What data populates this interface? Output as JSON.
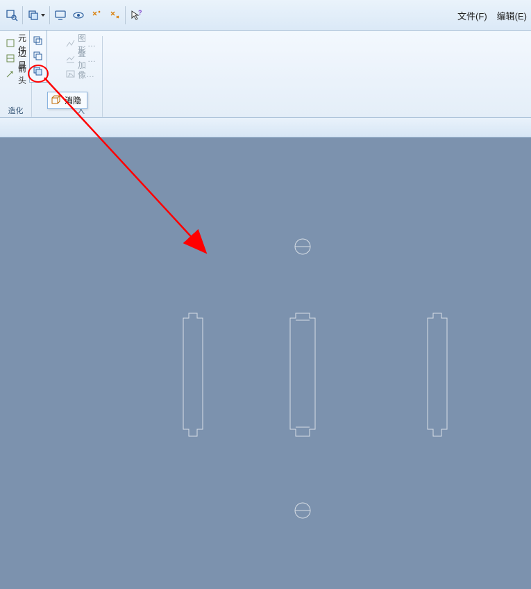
{
  "menus": {
    "file": "文件(F)",
    "edit": "编辑(E)"
  },
  "ribbon": {
    "group1": {
      "item1": "元件",
      "item2": "边显",
      "item3": "箭头",
      "label": "造化"
    },
    "group2": {
      "item1": "图形",
      "item2": "叠加",
      "item3": "像",
      "label": "入"
    }
  },
  "tooltip": {
    "label": "消隐"
  },
  "colors": {
    "accent_red": "#ff0000",
    "viewport_bg": "#7c92ae",
    "shape_stroke": "#d9dfe6"
  }
}
